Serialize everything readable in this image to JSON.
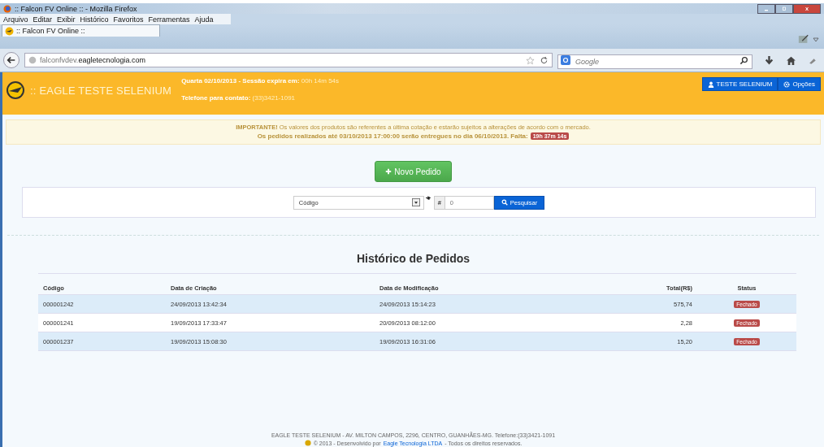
{
  "window": {
    "title": ":: Falcon FV Online :: - Mozilla Firefox"
  },
  "menu": [
    {
      "label": "Arquivo"
    },
    {
      "label": "Editar"
    },
    {
      "label": "Exibir"
    },
    {
      "label": "Histórico"
    },
    {
      "label": "Favoritos"
    },
    {
      "label": "Ferramentas"
    },
    {
      "label": "Ajuda"
    }
  ],
  "tab": {
    "title": ":: Falcon FV Online ::"
  },
  "address": {
    "url": "falconfvdev.**eagletecnologia.com**"
  },
  "web_search": {
    "placeholder": "Google"
  },
  "header": {
    "brand": ":: EAGLE TESTE SELENIUM",
    "date": "Quarta 02/10/2013 - Sessão expira em:",
    "expires": "00h 14m 54s",
    "phone_label": "Telefone para contato:",
    "phone": "(33)3421-1091",
    "user_button": "TESTE SELENIUM",
    "options_button": "Opções"
  },
  "notice": {
    "line_1": "**IMPORTANTE!** Os valores dos produtos são referentes a última cotação e estarão sujeitos a alterações de acordo com o mercado.",
    "line_2": "Os pedidos realizados até 03/10/2013 17:00:00 serão entregues no dia 06/10/2013. Falta:",
    "countdown": "19h 37m 14s"
  },
  "new_order_button": "Novo Pedido",
  "search": {
    "field": "Código",
    "hash": "#",
    "placeholder": "0",
    "button": "Pesquisar"
  },
  "history": {
    "title": "Histórico de Pedidos",
    "columns": [
      "Código",
      "Data de Criação",
      "Data de Modificação",
      "Total(R$)",
      "Status"
    ],
    "rows": [
      {
        "code": "000001242",
        "created": "24/09/2013 13:42:34",
        "modified": "24/09/2013 15:14:23",
        "total": "575,74",
        "status": "Fechado"
      },
      {
        "code": "000001241",
        "created": "19/09/2013 17:33:47",
        "modified": "20/09/2013 08:12:00",
        "total": "2,28",
        "status": "Fechado"
      },
      {
        "code": "000001237",
        "created": "19/09/2013 15:08:30",
        "modified": "19/09/2013 16:31:06",
        "total": "15,20",
        "status": "Fechado"
      }
    ]
  },
  "footer": {
    "line_1": "EAGLE TESTE SELENIUM - AV. MILTON CAMPOS, 2296, CENTRO, GUANHÃES-MG. Telefone:(33)3421-1091",
    "copyright": "© 2013 - Desenvolvido por",
    "link": "Eagle Tecnologia LTDA",
    "rights": "- Todos os direitos reservados."
  }
}
